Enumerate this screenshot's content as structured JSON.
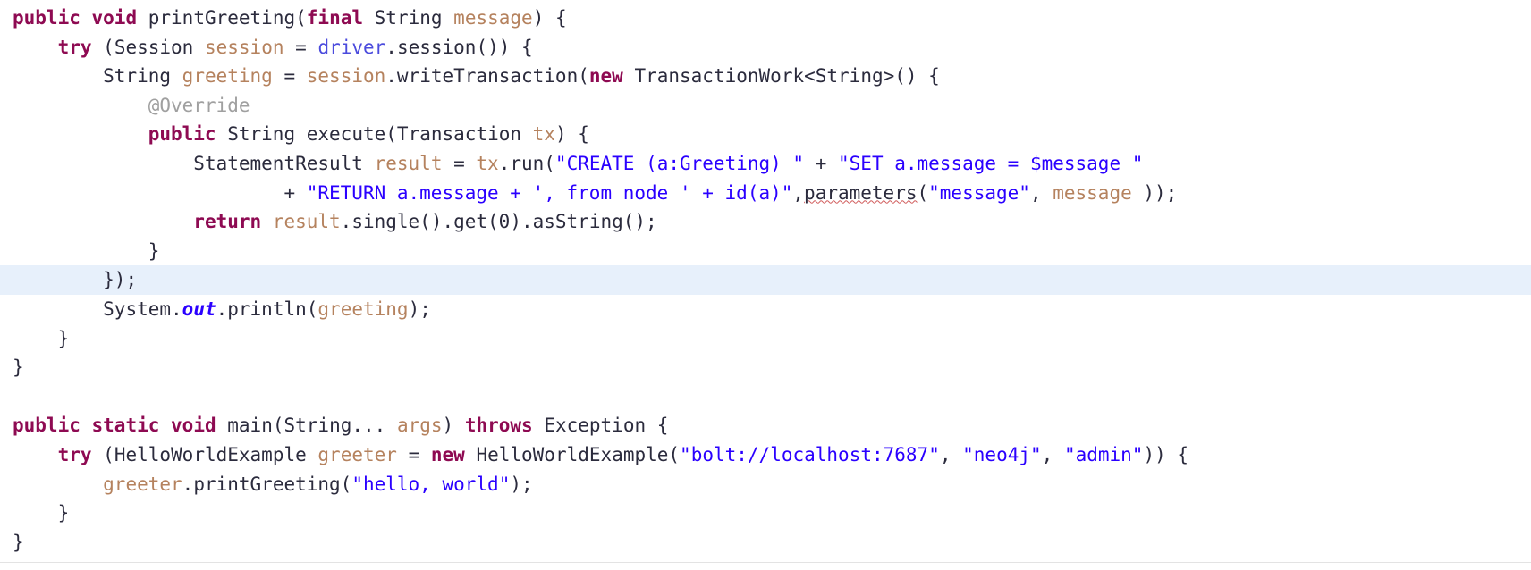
{
  "editor": {
    "language": "java",
    "font_size_px": 21,
    "background": "#ffffff",
    "current_line_highlight": "#e7f0fb",
    "colors": {
      "keyword": "#8e0a52",
      "string": "#2a00ff",
      "identifier": "#2b2b3d",
      "parameter_variable": "#b5825e",
      "instance_field": "#4b4bdd",
      "static_field": "#2a00ff",
      "annotation": "#a0a0a0",
      "warning_underline": "#d05a5a"
    }
  },
  "lines": [
    {
      "index": 0,
      "indent": "",
      "highlighted": false,
      "tokens": [
        {
          "t": "public",
          "c": "kw"
        },
        {
          "t": " ",
          "c": "plain"
        },
        {
          "t": "void",
          "c": "kw"
        },
        {
          "t": " ",
          "c": "plain"
        },
        {
          "t": "printGreeting",
          "c": "plain"
        },
        {
          "t": "(",
          "c": "punc"
        },
        {
          "t": "final",
          "c": "kw"
        },
        {
          "t": " ",
          "c": "plain"
        },
        {
          "t": "String",
          "c": "type"
        },
        {
          "t": " ",
          "c": "plain"
        },
        {
          "t": "message",
          "c": "var"
        },
        {
          "t": ") {",
          "c": "punc"
        }
      ]
    },
    {
      "index": 1,
      "indent": "    ",
      "highlighted": false,
      "tokens": [
        {
          "t": "try",
          "c": "kw"
        },
        {
          "t": " (",
          "c": "punc"
        },
        {
          "t": "Session",
          "c": "type"
        },
        {
          "t": " ",
          "c": "plain"
        },
        {
          "t": "session",
          "c": "var"
        },
        {
          "t": " = ",
          "c": "punc"
        },
        {
          "t": "driver",
          "c": "field"
        },
        {
          "t": ".session()) {",
          "c": "punc"
        }
      ]
    },
    {
      "index": 2,
      "indent": "        ",
      "highlighted": false,
      "tokens": [
        {
          "t": "String",
          "c": "type"
        },
        {
          "t": " ",
          "c": "plain"
        },
        {
          "t": "greeting",
          "c": "var"
        },
        {
          "t": " = ",
          "c": "punc"
        },
        {
          "t": "session",
          "c": "var"
        },
        {
          "t": ".writeTransaction(",
          "c": "punc"
        },
        {
          "t": "new",
          "c": "kw"
        },
        {
          "t": " ",
          "c": "plain"
        },
        {
          "t": "TransactionWork<String>() {",
          "c": "type"
        }
      ]
    },
    {
      "index": 3,
      "indent": "            ",
      "highlighted": false,
      "tokens": [
        {
          "t": "@Override",
          "c": "anno"
        }
      ]
    },
    {
      "index": 4,
      "indent": "            ",
      "highlighted": false,
      "tokens": [
        {
          "t": "public",
          "c": "kw"
        },
        {
          "t": " ",
          "c": "plain"
        },
        {
          "t": "String",
          "c": "type"
        },
        {
          "t": " ",
          "c": "plain"
        },
        {
          "t": "execute",
          "c": "plain"
        },
        {
          "t": "(",
          "c": "punc"
        },
        {
          "t": "Transaction",
          "c": "type"
        },
        {
          "t": " ",
          "c": "plain"
        },
        {
          "t": "tx",
          "c": "var"
        },
        {
          "t": ") {",
          "c": "punc"
        }
      ]
    },
    {
      "index": 5,
      "indent": "                ",
      "highlighted": false,
      "tokens": [
        {
          "t": "StatementResult",
          "c": "type"
        },
        {
          "t": " ",
          "c": "plain"
        },
        {
          "t": "result",
          "c": "var"
        },
        {
          "t": " = ",
          "c": "punc"
        },
        {
          "t": "tx",
          "c": "var"
        },
        {
          "t": ".run(",
          "c": "punc"
        },
        {
          "t": "\"CREATE (a:Greeting) \"",
          "c": "str"
        },
        {
          "t": " + ",
          "c": "punc"
        },
        {
          "t": "\"SET a.message = $message \"",
          "c": "str"
        }
      ]
    },
    {
      "index": 6,
      "indent": "                        ",
      "highlighted": false,
      "tokens": [
        {
          "t": "+ ",
          "c": "punc"
        },
        {
          "t": "\"RETURN a.message + ', from node ' + id(a)\"",
          "c": "str"
        },
        {
          "t": ",",
          "c": "punc"
        },
        {
          "t": "parameters",
          "c": "plain",
          "warn": true
        },
        {
          "t": "(",
          "c": "punc"
        },
        {
          "t": "\"message\"",
          "c": "str"
        },
        {
          "t": ", ",
          "c": "punc"
        },
        {
          "t": "message",
          "c": "var"
        },
        {
          "t": " ));",
          "c": "punc"
        }
      ]
    },
    {
      "index": 7,
      "indent": "                ",
      "highlighted": false,
      "tokens": [
        {
          "t": "return",
          "c": "kw"
        },
        {
          "t": " ",
          "c": "plain"
        },
        {
          "t": "result",
          "c": "var"
        },
        {
          "t": ".single().get(0).asString();",
          "c": "punc"
        }
      ]
    },
    {
      "index": 8,
      "indent": "            ",
      "highlighted": false,
      "tokens": [
        {
          "t": "}",
          "c": "punc"
        }
      ]
    },
    {
      "index": 9,
      "indent": "        ",
      "highlighted": true,
      "tokens": [
        {
          "t": "});",
          "c": "punc"
        }
      ]
    },
    {
      "index": 10,
      "indent": "        ",
      "highlighted": false,
      "tokens": [
        {
          "t": "System",
          "c": "type"
        },
        {
          "t": ".",
          "c": "punc"
        },
        {
          "t": "out",
          "c": "staticf"
        },
        {
          "t": ".println(",
          "c": "punc"
        },
        {
          "t": "greeting",
          "c": "var"
        },
        {
          "t": ");",
          "c": "punc"
        }
      ]
    },
    {
      "index": 11,
      "indent": "    ",
      "highlighted": false,
      "tokens": [
        {
          "t": "}",
          "c": "punc"
        }
      ]
    },
    {
      "index": 12,
      "indent": "",
      "highlighted": false,
      "tokens": [
        {
          "t": "}",
          "c": "punc"
        }
      ]
    },
    {
      "index": 13,
      "indent": "",
      "highlighted": false,
      "tokens": []
    },
    {
      "index": 14,
      "indent": "",
      "highlighted": false,
      "tokens": [
        {
          "t": "public",
          "c": "kw"
        },
        {
          "t": " ",
          "c": "plain"
        },
        {
          "t": "static",
          "c": "kw"
        },
        {
          "t": " ",
          "c": "plain"
        },
        {
          "t": "void",
          "c": "kw"
        },
        {
          "t": " ",
          "c": "plain"
        },
        {
          "t": "main",
          "c": "plain"
        },
        {
          "t": "(",
          "c": "punc"
        },
        {
          "t": "String",
          "c": "type"
        },
        {
          "t": "... ",
          "c": "punc"
        },
        {
          "t": "args",
          "c": "var"
        },
        {
          "t": ") ",
          "c": "punc"
        },
        {
          "t": "throws",
          "c": "kw"
        },
        {
          "t": " ",
          "c": "plain"
        },
        {
          "t": "Exception",
          "c": "type"
        },
        {
          "t": " {",
          "c": "punc"
        }
      ]
    },
    {
      "index": 15,
      "indent": "    ",
      "highlighted": false,
      "tokens": [
        {
          "t": "try",
          "c": "kw"
        },
        {
          "t": " (",
          "c": "punc"
        },
        {
          "t": "HelloWorldExample",
          "c": "type"
        },
        {
          "t": " ",
          "c": "plain"
        },
        {
          "t": "greeter",
          "c": "var"
        },
        {
          "t": " = ",
          "c": "punc"
        },
        {
          "t": "new",
          "c": "kw"
        },
        {
          "t": " ",
          "c": "plain"
        },
        {
          "t": "HelloWorldExample",
          "c": "type"
        },
        {
          "t": "(",
          "c": "punc"
        },
        {
          "t": "\"bolt://localhost:7687\"",
          "c": "str"
        },
        {
          "t": ", ",
          "c": "punc"
        },
        {
          "t": "\"neo4j\"",
          "c": "str"
        },
        {
          "t": ", ",
          "c": "punc"
        },
        {
          "t": "\"admin\"",
          "c": "str"
        },
        {
          "t": ")) {",
          "c": "punc"
        }
      ]
    },
    {
      "index": 16,
      "indent": "        ",
      "highlighted": false,
      "tokens": [
        {
          "t": "greeter",
          "c": "var"
        },
        {
          "t": ".printGreeting(",
          "c": "punc"
        },
        {
          "t": "\"hello, world\"",
          "c": "str"
        },
        {
          "t": ");",
          "c": "punc"
        }
      ]
    },
    {
      "index": 17,
      "indent": "    ",
      "highlighted": false,
      "tokens": [
        {
          "t": "}",
          "c": "punc"
        }
      ]
    },
    {
      "index": 18,
      "indent": "",
      "highlighted": false,
      "tokens": [
        {
          "t": "}",
          "c": "punc"
        }
      ]
    }
  ]
}
